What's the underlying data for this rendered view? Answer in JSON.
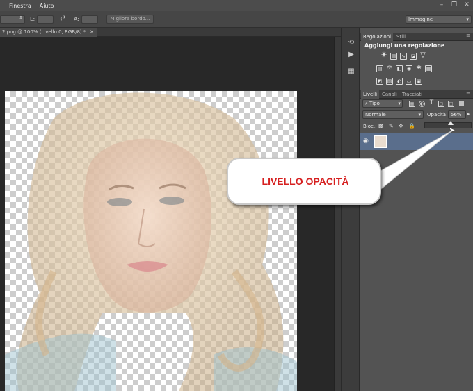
{
  "menubar": {
    "items": [
      "Finestra",
      "Aiuto"
    ]
  },
  "options": {
    "l_label": "L:",
    "a_label": "A:",
    "refine_button": "Migliora bordo...",
    "mode_select": "Immagine"
  },
  "document": {
    "tab_title": "2.png @ 100% (Livello 0, RGB/8) *"
  },
  "adjust_panel": {
    "tabs": [
      "Regolazioni",
      "Stili"
    ],
    "heading": "Aggiungi una regolazione"
  },
  "layers_panel": {
    "tabs": [
      "Livelli",
      "Canali",
      "Tracciati"
    ],
    "filter_kind": "Tipo",
    "blend_mode": "Normale",
    "opacity_label": "Opacità:",
    "opacity_value": "56%",
    "lock_label": "Bloc.:",
    "opacity_slider_fraction": 0.56
  },
  "callout": {
    "text": "LIVELLO OPACITÀ"
  },
  "colors": {
    "accent": "#d62020",
    "selected_layer": "#5a6e8c"
  }
}
